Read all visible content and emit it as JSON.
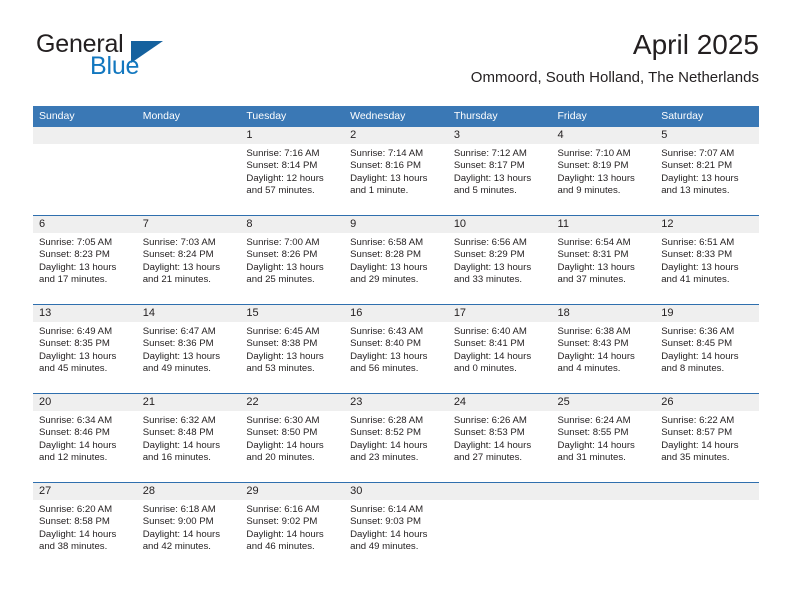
{
  "brand": {
    "word1": "General",
    "word2": "Blue",
    "triangle_icon": "triangle-icon",
    "accent_color": "#1277bf",
    "triangle_color": "#15619e"
  },
  "header": {
    "title": "April 2025",
    "subtitle": "Ommoord, South Holland, The Netherlands"
  },
  "theme": {
    "header_blue": "#3a78b5",
    "row_divider": "#2f6fae",
    "daynum_band": "#efefef",
    "text": "#231f20"
  },
  "weekday_headers": [
    "Sunday",
    "Monday",
    "Tuesday",
    "Wednesday",
    "Thursday",
    "Friday",
    "Saturday"
  ],
  "weeks": [
    [
      {
        "day": "",
        "sunrise": "",
        "sunset": "",
        "daylight_line1": "",
        "daylight_line2": ""
      },
      {
        "day": "",
        "sunrise": "",
        "sunset": "",
        "daylight_line1": "",
        "daylight_line2": ""
      },
      {
        "day": "1",
        "sunrise": "Sunrise: 7:16 AM",
        "sunset": "Sunset: 8:14 PM",
        "daylight_line1": "Daylight: 12 hours",
        "daylight_line2": "and 57 minutes."
      },
      {
        "day": "2",
        "sunrise": "Sunrise: 7:14 AM",
        "sunset": "Sunset: 8:16 PM",
        "daylight_line1": "Daylight: 13 hours",
        "daylight_line2": "and 1 minute."
      },
      {
        "day": "3",
        "sunrise": "Sunrise: 7:12 AM",
        "sunset": "Sunset: 8:17 PM",
        "daylight_line1": "Daylight: 13 hours",
        "daylight_line2": "and 5 minutes."
      },
      {
        "day": "4",
        "sunrise": "Sunrise: 7:10 AM",
        "sunset": "Sunset: 8:19 PM",
        "daylight_line1": "Daylight: 13 hours",
        "daylight_line2": "and 9 minutes."
      },
      {
        "day": "5",
        "sunrise": "Sunrise: 7:07 AM",
        "sunset": "Sunset: 8:21 PM",
        "daylight_line1": "Daylight: 13 hours",
        "daylight_line2": "and 13 minutes."
      }
    ],
    [
      {
        "day": "6",
        "sunrise": "Sunrise: 7:05 AM",
        "sunset": "Sunset: 8:23 PM",
        "daylight_line1": "Daylight: 13 hours",
        "daylight_line2": "and 17 minutes."
      },
      {
        "day": "7",
        "sunrise": "Sunrise: 7:03 AM",
        "sunset": "Sunset: 8:24 PM",
        "daylight_line1": "Daylight: 13 hours",
        "daylight_line2": "and 21 minutes."
      },
      {
        "day": "8",
        "sunrise": "Sunrise: 7:00 AM",
        "sunset": "Sunset: 8:26 PM",
        "daylight_line1": "Daylight: 13 hours",
        "daylight_line2": "and 25 minutes."
      },
      {
        "day": "9",
        "sunrise": "Sunrise: 6:58 AM",
        "sunset": "Sunset: 8:28 PM",
        "daylight_line1": "Daylight: 13 hours",
        "daylight_line2": "and 29 minutes."
      },
      {
        "day": "10",
        "sunrise": "Sunrise: 6:56 AM",
        "sunset": "Sunset: 8:29 PM",
        "daylight_line1": "Daylight: 13 hours",
        "daylight_line2": "and 33 minutes."
      },
      {
        "day": "11",
        "sunrise": "Sunrise: 6:54 AM",
        "sunset": "Sunset: 8:31 PM",
        "daylight_line1": "Daylight: 13 hours",
        "daylight_line2": "and 37 minutes."
      },
      {
        "day": "12",
        "sunrise": "Sunrise: 6:51 AM",
        "sunset": "Sunset: 8:33 PM",
        "daylight_line1": "Daylight: 13 hours",
        "daylight_line2": "and 41 minutes."
      }
    ],
    [
      {
        "day": "13",
        "sunrise": "Sunrise: 6:49 AM",
        "sunset": "Sunset: 8:35 PM",
        "daylight_line1": "Daylight: 13 hours",
        "daylight_line2": "and 45 minutes."
      },
      {
        "day": "14",
        "sunrise": "Sunrise: 6:47 AM",
        "sunset": "Sunset: 8:36 PM",
        "daylight_line1": "Daylight: 13 hours",
        "daylight_line2": "and 49 minutes."
      },
      {
        "day": "15",
        "sunrise": "Sunrise: 6:45 AM",
        "sunset": "Sunset: 8:38 PM",
        "daylight_line1": "Daylight: 13 hours",
        "daylight_line2": "and 53 minutes."
      },
      {
        "day": "16",
        "sunrise": "Sunrise: 6:43 AM",
        "sunset": "Sunset: 8:40 PM",
        "daylight_line1": "Daylight: 13 hours",
        "daylight_line2": "and 56 minutes."
      },
      {
        "day": "17",
        "sunrise": "Sunrise: 6:40 AM",
        "sunset": "Sunset: 8:41 PM",
        "daylight_line1": "Daylight: 14 hours",
        "daylight_line2": "and 0 minutes."
      },
      {
        "day": "18",
        "sunrise": "Sunrise: 6:38 AM",
        "sunset": "Sunset: 8:43 PM",
        "daylight_line1": "Daylight: 14 hours",
        "daylight_line2": "and 4 minutes."
      },
      {
        "day": "19",
        "sunrise": "Sunrise: 6:36 AM",
        "sunset": "Sunset: 8:45 PM",
        "daylight_line1": "Daylight: 14 hours",
        "daylight_line2": "and 8 minutes."
      }
    ],
    [
      {
        "day": "20",
        "sunrise": "Sunrise: 6:34 AM",
        "sunset": "Sunset: 8:46 PM",
        "daylight_line1": "Daylight: 14 hours",
        "daylight_line2": "and 12 minutes."
      },
      {
        "day": "21",
        "sunrise": "Sunrise: 6:32 AM",
        "sunset": "Sunset: 8:48 PM",
        "daylight_line1": "Daylight: 14 hours",
        "daylight_line2": "and 16 minutes."
      },
      {
        "day": "22",
        "sunrise": "Sunrise: 6:30 AM",
        "sunset": "Sunset: 8:50 PM",
        "daylight_line1": "Daylight: 14 hours",
        "daylight_line2": "and 20 minutes."
      },
      {
        "day": "23",
        "sunrise": "Sunrise: 6:28 AM",
        "sunset": "Sunset: 8:52 PM",
        "daylight_line1": "Daylight: 14 hours",
        "daylight_line2": "and 23 minutes."
      },
      {
        "day": "24",
        "sunrise": "Sunrise: 6:26 AM",
        "sunset": "Sunset: 8:53 PM",
        "daylight_line1": "Daylight: 14 hours",
        "daylight_line2": "and 27 minutes."
      },
      {
        "day": "25",
        "sunrise": "Sunrise: 6:24 AM",
        "sunset": "Sunset: 8:55 PM",
        "daylight_line1": "Daylight: 14 hours",
        "daylight_line2": "and 31 minutes."
      },
      {
        "day": "26",
        "sunrise": "Sunrise: 6:22 AM",
        "sunset": "Sunset: 8:57 PM",
        "daylight_line1": "Daylight: 14 hours",
        "daylight_line2": "and 35 minutes."
      }
    ],
    [
      {
        "day": "27",
        "sunrise": "Sunrise: 6:20 AM",
        "sunset": "Sunset: 8:58 PM",
        "daylight_line1": "Daylight: 14 hours",
        "daylight_line2": "and 38 minutes."
      },
      {
        "day": "28",
        "sunrise": "Sunrise: 6:18 AM",
        "sunset": "Sunset: 9:00 PM",
        "daylight_line1": "Daylight: 14 hours",
        "daylight_line2": "and 42 minutes."
      },
      {
        "day": "29",
        "sunrise": "Sunrise: 6:16 AM",
        "sunset": "Sunset: 9:02 PM",
        "daylight_line1": "Daylight: 14 hours",
        "daylight_line2": "and 46 minutes."
      },
      {
        "day": "30",
        "sunrise": "Sunrise: 6:14 AM",
        "sunset": "Sunset: 9:03 PM",
        "daylight_line1": "Daylight: 14 hours",
        "daylight_line2": "and 49 minutes."
      },
      {
        "day": "",
        "sunrise": "",
        "sunset": "",
        "daylight_line1": "",
        "daylight_line2": ""
      },
      {
        "day": "",
        "sunrise": "",
        "sunset": "",
        "daylight_line1": "",
        "daylight_line2": ""
      },
      {
        "day": "",
        "sunrise": "",
        "sunset": "",
        "daylight_line1": "",
        "daylight_line2": ""
      }
    ]
  ]
}
